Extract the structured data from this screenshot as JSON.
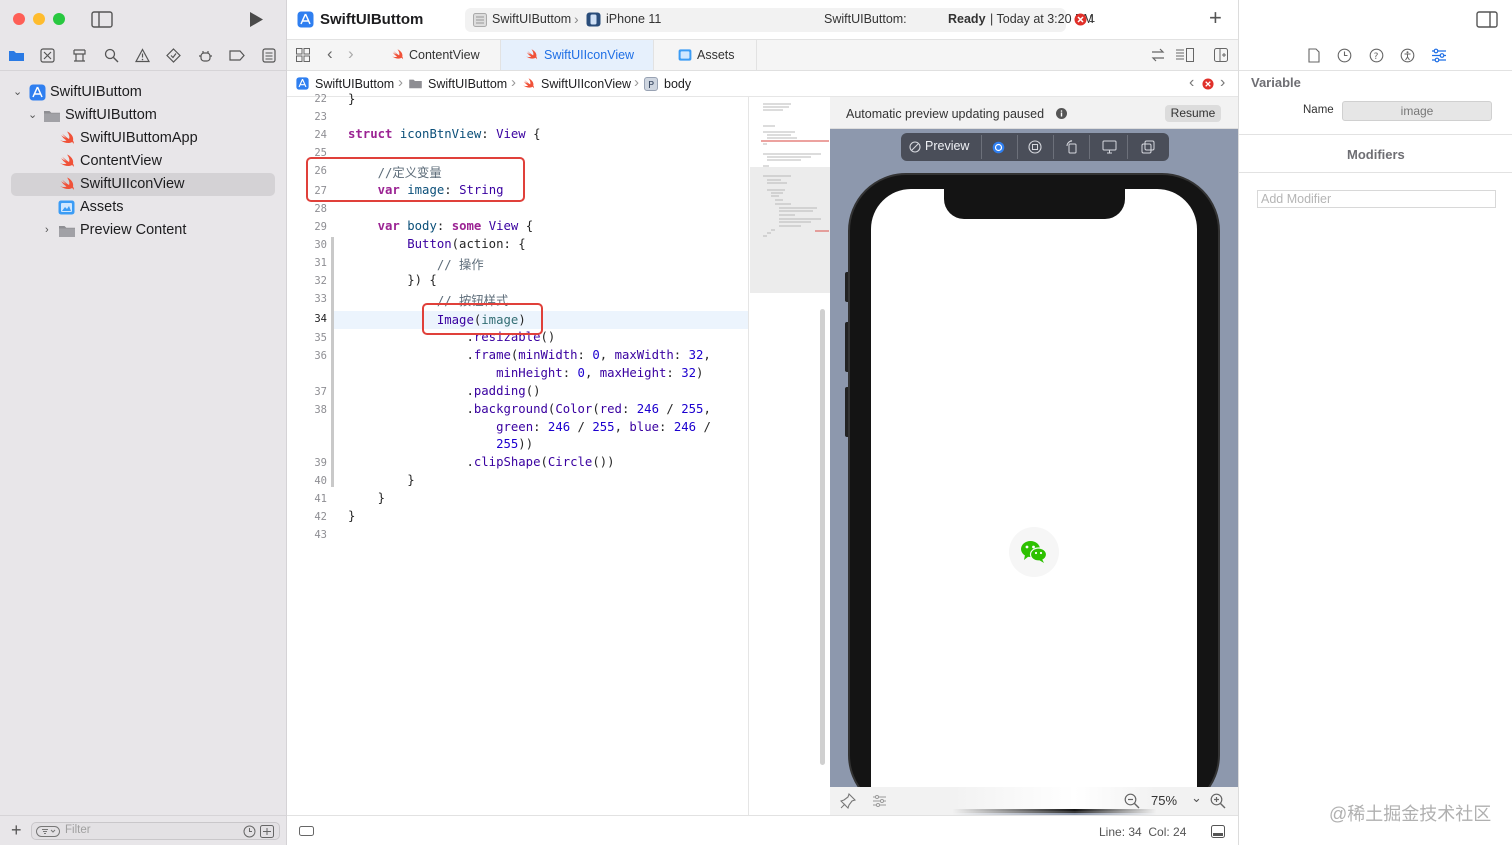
{
  "window": {
    "project_name": "SwiftUIButtom",
    "scheme": "SwiftUIButtom",
    "device": "iPhone 11",
    "status_project": "SwiftUIButtom:",
    "status_state": "Ready",
    "status_time": "| Today at 3:20 PM",
    "error_count": "1"
  },
  "navigator": {
    "items": [
      {
        "label": "SwiftUIButtom",
        "icon": "app-project-icon"
      },
      {
        "label": "SwiftUIButtom",
        "icon": "folder-icon"
      },
      {
        "label": "SwiftUIButtomApp",
        "icon": "swift-file-icon"
      },
      {
        "label": "ContentView",
        "icon": "swift-file-icon"
      },
      {
        "label": "SwiftUIIconView",
        "icon": "swift-file-icon"
      },
      {
        "label": "Assets",
        "icon": "assets-icon"
      },
      {
        "label": "Preview Content",
        "icon": "folder-icon"
      }
    ],
    "filter_placeholder": "Filter"
  },
  "tabs": [
    {
      "label": "ContentView"
    },
    {
      "label": "SwiftUIIconView"
    },
    {
      "label": "Assets"
    }
  ],
  "jumpbar": [
    "SwiftUIButtom",
    "SwiftUIButtom",
    "SwiftUIIconView",
    "body"
  ],
  "code": {
    "lines": [
      "22",
      "23",
      "24",
      "25",
      "26",
      "27",
      "28",
      "29",
      "30",
      "31",
      "32",
      "33",
      "34",
      "35",
      "36",
      "",
      "37",
      "38",
      "",
      "",
      "39",
      "40",
      "41",
      "42",
      "43"
    ]
  },
  "canvas": {
    "paused_message": "Automatic preview updating paused",
    "resume_label": "Resume",
    "preview_label": "Preview",
    "zoom": "75%"
  },
  "inspector": {
    "section_title": "Variable",
    "name_label": "Name",
    "name_value": "image",
    "modifiers_title": "Modifiers",
    "add_modifier_placeholder": "Add Modifier"
  },
  "status": {
    "line_col": "Line: 34  Col: 24"
  },
  "watermark": "@稀土掘金技术社区",
  "colors": {
    "accent": "#1f6fe5",
    "highlight_box": "#e0403a",
    "swift_orange": "#f05138",
    "wechat_green": "#2dc100"
  }
}
